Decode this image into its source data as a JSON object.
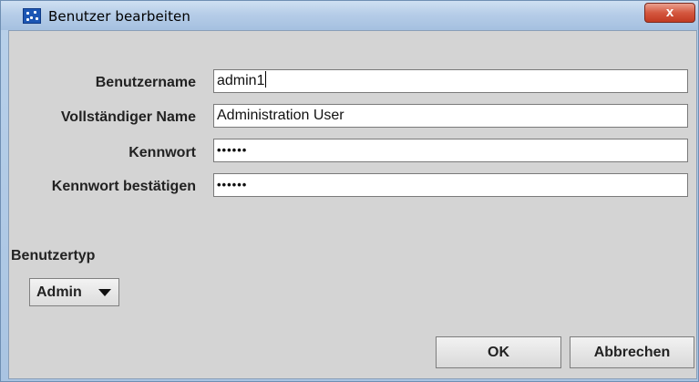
{
  "window": {
    "title": "Benutzer bearbeiten",
    "close_symbol": "x",
    "icon": "app-icon"
  },
  "form": {
    "username": {
      "label": "Benutzername",
      "value": "admin1"
    },
    "fullname": {
      "label": "Vollständiger Name",
      "value": "Administration User"
    },
    "password": {
      "label": "Kennwort",
      "value": "••••••"
    },
    "password_confirm": {
      "label": "Kennwort bestätigen",
      "value": "••••••"
    }
  },
  "usertype": {
    "label": "Benutzertyp",
    "selected": "Admin"
  },
  "buttons": {
    "ok": "OK",
    "cancel": "Abbrechen"
  },
  "colors": {
    "panel": "#d4d4d4",
    "titlebar": "#b6cde8",
    "close": "#c94a33"
  }
}
